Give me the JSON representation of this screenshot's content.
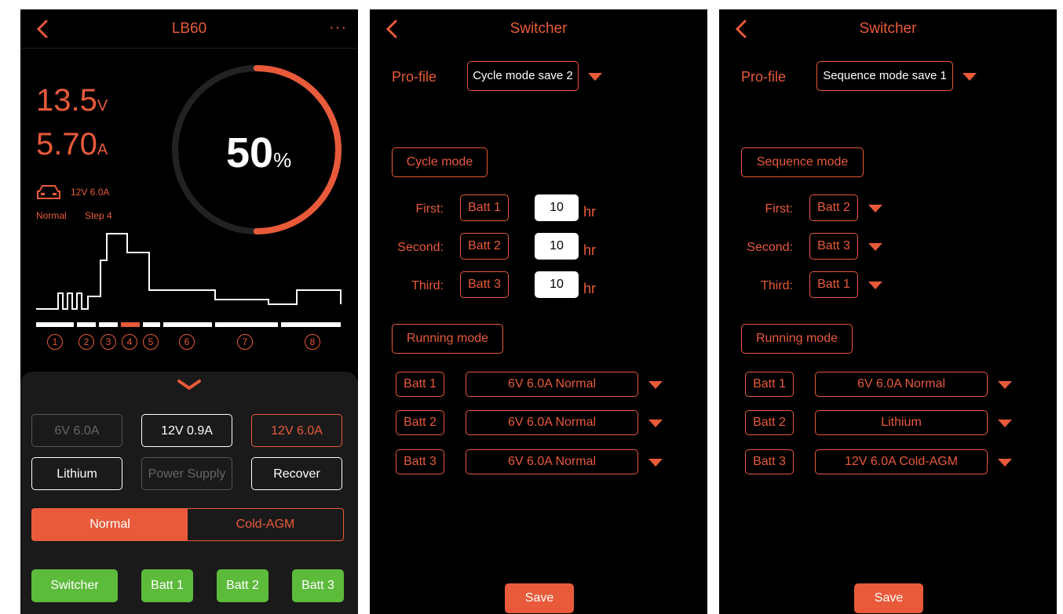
{
  "phone1": {
    "title": "LB60",
    "more": "···",
    "voltage": "13.5",
    "voltage_unit": "V",
    "current": "5.70",
    "current_unit": "A",
    "battery_info": "12V 6.0A",
    "mode": "Normal",
    "step": "Step 4",
    "percent": "50",
    "percent_unit": "%",
    "progress_fraction": 0.5,
    "steps": [
      "1",
      "2",
      "3",
      "4",
      "5",
      "6",
      "7",
      "8"
    ],
    "active_step": 4,
    "buttons_row1": [
      "6V 6.0A",
      "12V 0.9A",
      "12V 6.0A"
    ],
    "buttons_row2": [
      "Lithium",
      "Power Supply",
      "Recover"
    ],
    "segment": [
      "Normal",
      "Cold-AGM"
    ],
    "bottom_buttons": [
      "Switcher",
      "Batt 1",
      "Batt 2",
      "Batt 3"
    ]
  },
  "phone2": {
    "title": "Switcher",
    "profile_label": "Pro-file",
    "profile_value": "Cycle mode save 2",
    "mode_button": "Cycle mode",
    "rows": [
      {
        "label": "First:",
        "batt": "Batt 1",
        "hours": "10",
        "unit": "hr"
      },
      {
        "label": "Second:",
        "batt": "Batt 2",
        "hours": "10",
        "unit": "hr"
      },
      {
        "label": "Third:",
        "batt": "Batt 3",
        "hours": "10",
        "unit": "hr"
      }
    ],
    "running_mode": "Running mode",
    "running": [
      {
        "batt": "Batt 1",
        "value": "6V 6.0A Normal"
      },
      {
        "batt": "Batt 2",
        "value": "6V 6.0A Normal"
      },
      {
        "batt": "Batt 3",
        "value": "6V 6.0A Normal"
      }
    ],
    "save": "Save"
  },
  "phone3": {
    "title": "Switcher",
    "profile_label": "Pro-file",
    "profile_value": "Sequence mode save 1",
    "mode_button": "Sequence mode",
    "rows": [
      {
        "label": "First:",
        "batt": "Batt 2"
      },
      {
        "label": "Second:",
        "batt": "Batt 3"
      },
      {
        "label": "Third:",
        "batt": "Batt 1"
      }
    ],
    "running_mode": "Running mode",
    "running": [
      {
        "batt": "Batt 1",
        "value": "6V 6.0A Normal"
      },
      {
        "batt": "Batt 2",
        "value": "Lithium"
      },
      {
        "batt": "Batt 3",
        "value": "12V 6.0A Cold-AGM"
      }
    ],
    "save": "Save"
  },
  "colors": {
    "accent": "#e85a3a",
    "green": "#5dbb3b",
    "background": "#000000"
  }
}
